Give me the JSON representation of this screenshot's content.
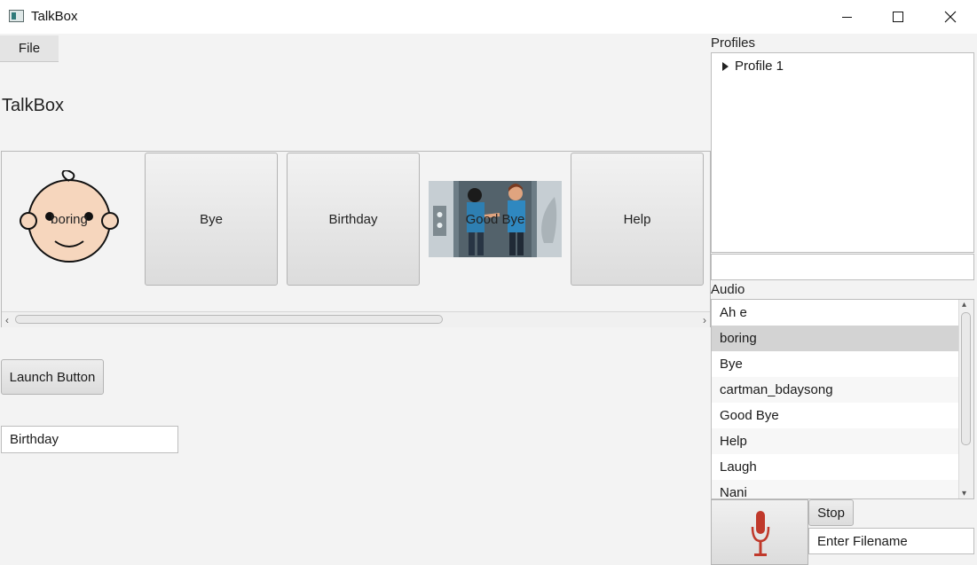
{
  "window": {
    "title": "TalkBox"
  },
  "menu": {
    "file": "File"
  },
  "main": {
    "heading": "TalkBox",
    "tiles": [
      {
        "label": "boring",
        "kind": "image",
        "icon": "baby-face-icon"
      },
      {
        "label": "Bye",
        "kind": "button"
      },
      {
        "label": "Birthday",
        "kind": "button"
      },
      {
        "label": "Good Bye",
        "kind": "image",
        "icon": "people-elevator-icon"
      },
      {
        "label": "Help",
        "kind": "button"
      }
    ],
    "launch_label": "Launch Button",
    "text_value": "Birthday"
  },
  "sidebar": {
    "profiles_label": "Profiles",
    "profiles": [
      "Profile 1"
    ],
    "profile_input_value": "",
    "audio_label": "Audio",
    "audio_items": [
      "Ah e",
      "boring",
      "Bye",
      "cartman_bdaysong",
      "Good Bye",
      "Help",
      "Laugh",
      "Nani"
    ],
    "selected_audio": "boring",
    "stop_label": "Stop",
    "filename_placeholder": "Enter Filename",
    "record_icon": "microphone-icon"
  },
  "colors": {
    "accent_mic": "#c0392b",
    "selected_row": "#d3d3d3"
  }
}
